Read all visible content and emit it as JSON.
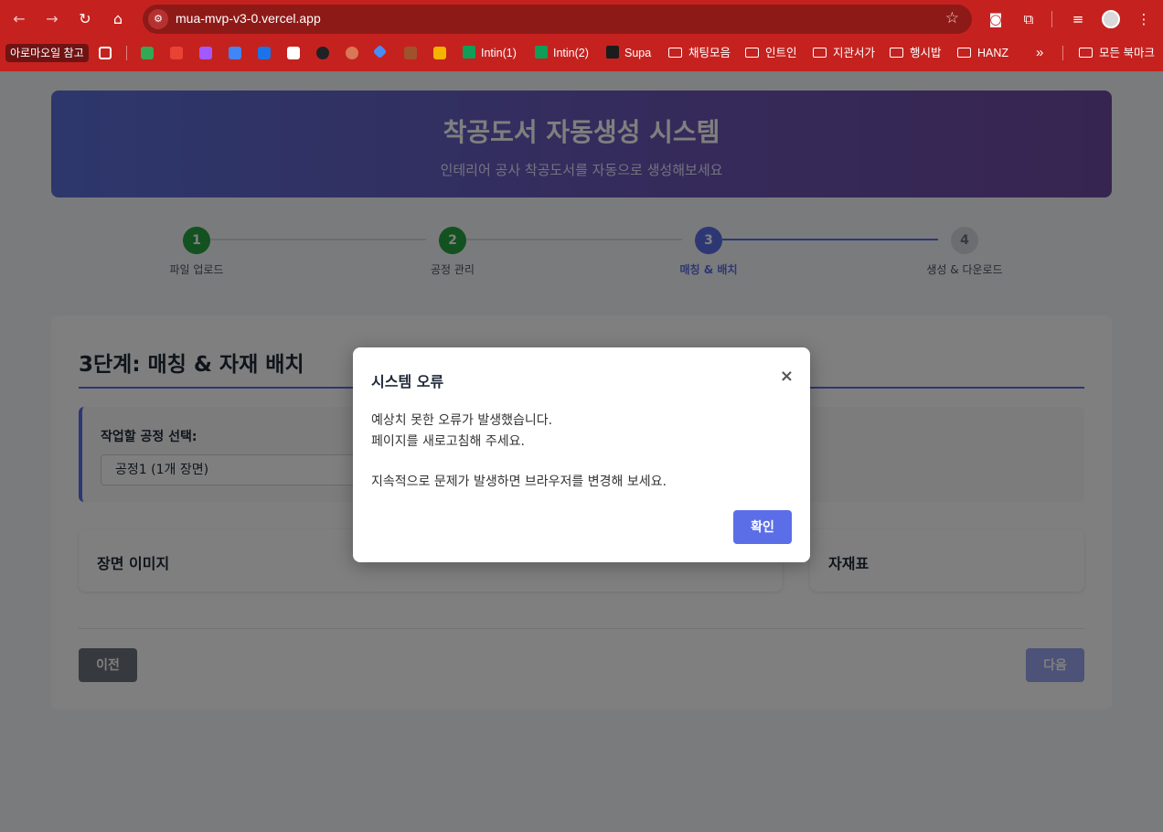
{
  "browser": {
    "url": "mua-mvp-v3-0.vercel.app",
    "bookmarks": {
      "first_chip": "아로마오일 참고",
      "intin1": "Intin(1)",
      "intin2": "Intin(2)",
      "supa": "Supa",
      "folder1": "채팅모음",
      "folder2": "인트인",
      "folder3": "지관서가",
      "folder4": "행시밥",
      "folder5": "HANZ",
      "more": "»",
      "all": "모든 북마크"
    }
  },
  "hero": {
    "title": "착공도서 자동생성 시스템",
    "subtitle": "인테리어 공사 착공도서를 자동으로 생성해보세요"
  },
  "steps": [
    {
      "num": "1",
      "label": "파일 업로드",
      "status": "done"
    },
    {
      "num": "2",
      "label": "공정 관리",
      "status": "done"
    },
    {
      "num": "3",
      "label": "매칭 & 배치",
      "status": "active"
    },
    {
      "num": "4",
      "label": "생성 & 다운로드",
      "status": "todo"
    }
  ],
  "card": {
    "title": "3단계: 매칭 & 자재 배치",
    "select_label": "작업할 공정 선택:",
    "select_value": "공정1 (1개 장면)",
    "panel_scene": "장면 이미지",
    "panel_material": "자재표",
    "prev": "이전",
    "next": "다음"
  },
  "modal": {
    "title": "시스템 오류",
    "close": "×",
    "line1": "예상치 못한 오류가 발생했습니다.",
    "line2": "페이지를 새로고침해 주세요.",
    "line3": "지속적으로 문제가 발생하면 브라우저를 변경해 보세요.",
    "ok": "확인"
  },
  "colors": {
    "chrome": "#c5221f",
    "accent": "#5b6ee8",
    "done": "#27a243"
  }
}
